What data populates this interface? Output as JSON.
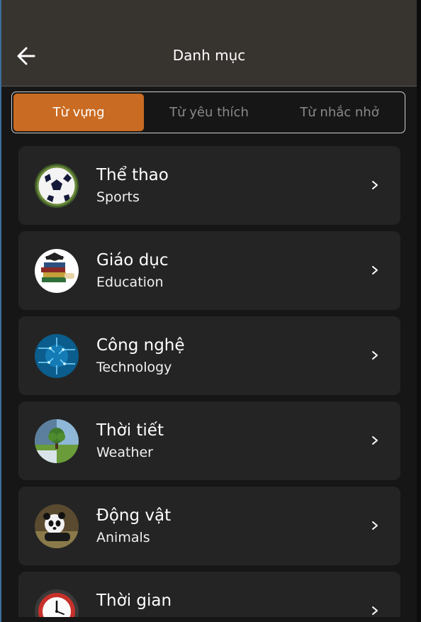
{
  "header": {
    "title": "Danh mục",
    "back_icon": "arrow-left-icon"
  },
  "tabs": [
    {
      "label": "Từ vựng",
      "active": true
    },
    {
      "label": "Từ yêu thích",
      "active": false
    },
    {
      "label": "Từ nhắc nhở",
      "active": false
    }
  ],
  "categories": [
    {
      "title": "Thể thao",
      "subtitle": "Sports",
      "icon": "soccer-ball-icon"
    },
    {
      "title": "Giáo dục",
      "subtitle": "Education",
      "icon": "books-icon"
    },
    {
      "title": "Công nghệ",
      "subtitle": "Technology",
      "icon": "circuit-board-icon"
    },
    {
      "title": "Thời tiết",
      "subtitle": "Weather",
      "icon": "tree-landscape-icon"
    },
    {
      "title": "Động vật",
      "subtitle": "Animals",
      "icon": "panda-icon"
    },
    {
      "title": "Thời gian",
      "subtitle": "",
      "icon": "clock-icon"
    }
  ],
  "colors": {
    "accent": "#c96b22",
    "appbar": "#37332f",
    "background": "#161616",
    "card": "#242424"
  }
}
